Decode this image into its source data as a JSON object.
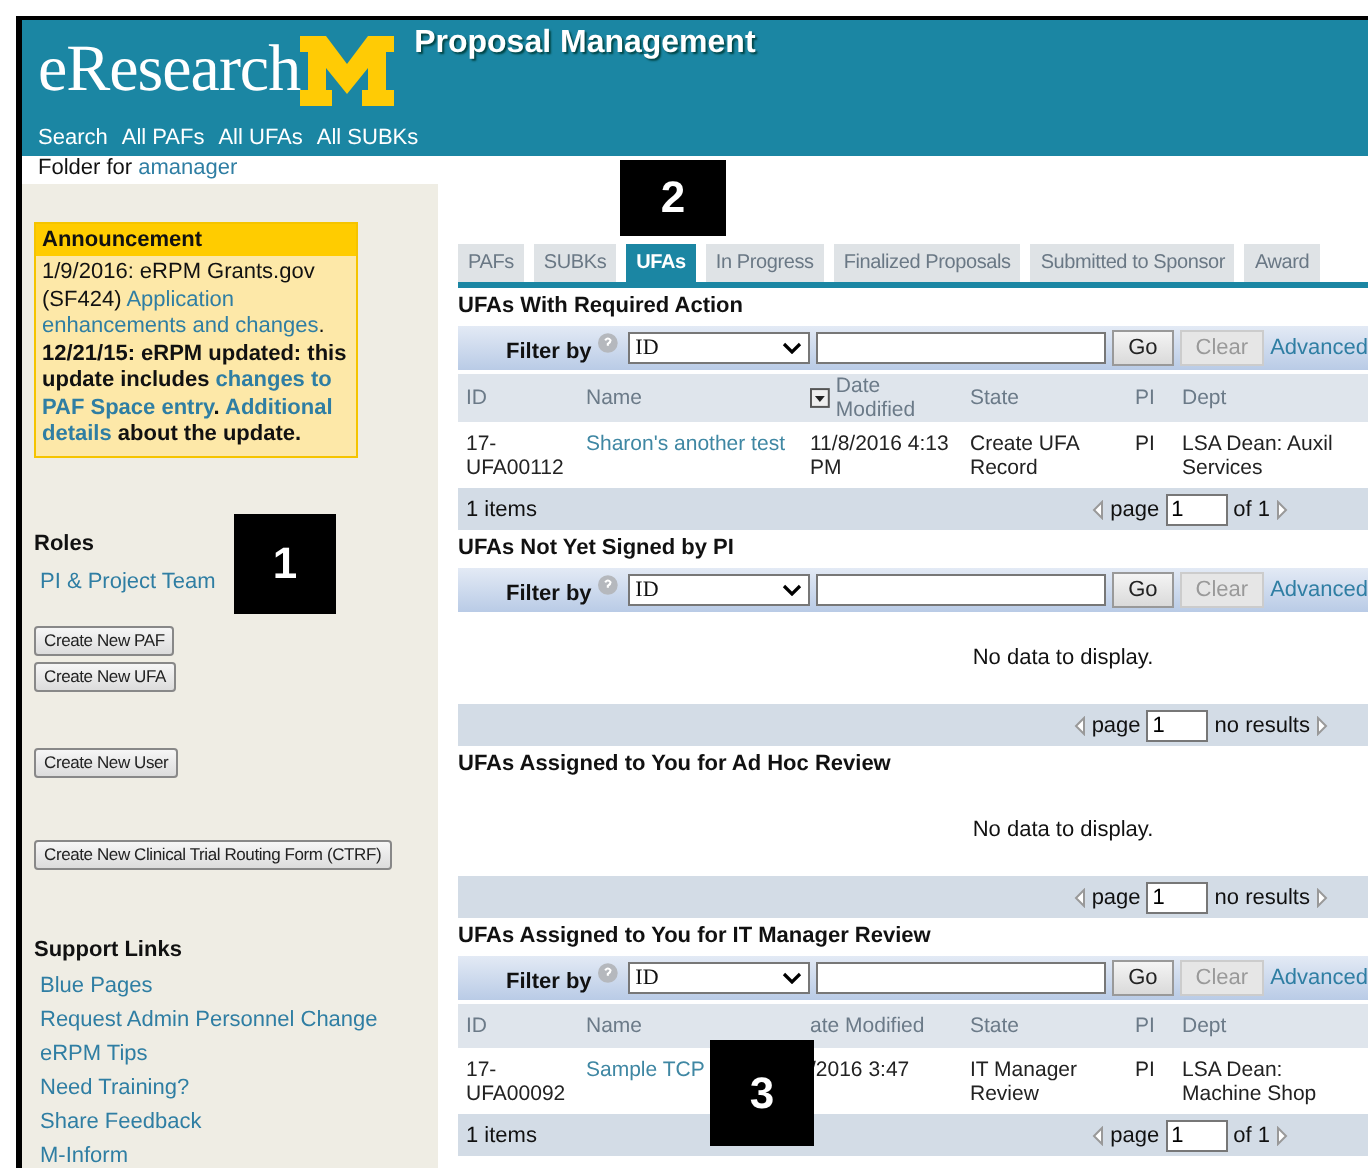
{
  "header": {
    "logo_text": "eResearch",
    "title": "Proposal Management",
    "nav": [
      "Search",
      "All PAFs",
      "All UFAs",
      "All SUBKs"
    ]
  },
  "folder": {
    "label": "Folder for",
    "user": "amanager"
  },
  "sidebar": {
    "announcement": {
      "title": "Announcement",
      "lines": [
        [
          {
            "kind": "text",
            "text": "1/9/2016: eRPM Grants.gov"
          }
        ],
        [
          {
            "kind": "text",
            "text": "(SF424) "
          },
          {
            "kind": "link",
            "text": "Application"
          }
        ],
        [
          {
            "kind": "link",
            "text": "enhancements and changes"
          },
          {
            "kind": "text",
            "text": "."
          }
        ],
        [
          {
            "kind": "bold",
            "text": "12/21/15: eRPM updated: this"
          }
        ],
        [
          {
            "kind": "bold",
            "text": "update includes "
          },
          {
            "kind": "boldlink",
            "text": "changes to"
          }
        ],
        [
          {
            "kind": "boldlink",
            "text": "PAF Space entry"
          },
          {
            "kind": "bold",
            "text": ". "
          },
          {
            "kind": "boldlink",
            "text": "Additional"
          }
        ],
        [
          {
            "kind": "boldlink",
            "text": "details"
          },
          {
            "kind": "bold",
            "text": " about the update."
          }
        ]
      ]
    },
    "roles": {
      "title": "Roles",
      "items": [
        "PI & Project Team"
      ]
    },
    "button_groups": [
      [
        "Create New PAF",
        "Create New UFA"
      ],
      [
        "Create New User"
      ],
      [
        "Create New Clinical Trial Routing Form (CTRF)"
      ]
    ],
    "support": {
      "title": "Support Links",
      "links": [
        "Blue Pages",
        "Request Admin Personnel Change",
        "eRPM Tips",
        "Need Training?",
        "Share Feedback",
        "M-Inform"
      ]
    }
  },
  "tabs": [
    {
      "label": "PAFs",
      "selected": false
    },
    {
      "label": "SUBKs",
      "selected": false
    },
    {
      "label": "UFAs",
      "selected": true
    },
    {
      "label": "In Progress",
      "selected": false
    },
    {
      "label": "Finalized Proposals",
      "selected": false
    },
    {
      "label": "Submitted to Sponsor",
      "selected": false
    },
    {
      "label": "Award",
      "selected": false
    }
  ],
  "sections": [
    {
      "title": "UFAs With Required Action",
      "filter": {
        "label": "Filter by",
        "field": "ID",
        "go": "Go",
        "clear": "Clear",
        "clear_disabled": true,
        "advanced": "Advanced"
      },
      "columns": [
        {
          "label": "ID",
          "sorted": false
        },
        {
          "label": "Name",
          "sorted": false
        },
        {
          "label": "Date Modified",
          "sorted": true
        },
        {
          "label": "State",
          "sorted": false
        },
        {
          "label": "PI",
          "sorted": false
        },
        {
          "label": "Dept",
          "sorted": false
        }
      ],
      "rows": [
        {
          "id": "17-UFA00112",
          "name": "Sharon's another test",
          "date": "11/8/2016 4:13 PM",
          "state": "Create UFA Record",
          "pi": "PI",
          "dept": "LSA Dean: Auxil Services"
        }
      ],
      "footer": {
        "count": "1 items",
        "page_label": "page",
        "page": "1",
        "total": "of 1"
      }
    },
    {
      "title": "UFAs Not Yet Signed by PI",
      "filter": {
        "label": "Filter by",
        "field": "ID",
        "go": "Go",
        "clear": "Clear",
        "clear_disabled": true,
        "advanced": "Advanced"
      },
      "empty": "No data to display.",
      "footer": {
        "page_label": "page",
        "page": "1",
        "total": "no results"
      }
    },
    {
      "title": "UFAs Assigned to You for Ad Hoc Review",
      "empty": "No data to display.",
      "footer": {
        "page_label": "page",
        "page": "1",
        "total": "no results"
      }
    },
    {
      "title": "UFAs Assigned to You for IT Manager Review",
      "filter": {
        "label": "Filter by",
        "field": "ID",
        "go": "Go",
        "clear": "Clear",
        "clear_disabled": true,
        "advanced": "Advanced"
      },
      "columns": [
        {
          "label": "ID",
          "sorted": false
        },
        {
          "label": "Name",
          "sorted": false
        },
        {
          "label": "ate Modified",
          "sorted": false
        },
        {
          "label": "State",
          "sorted": false
        },
        {
          "label": "PI",
          "sorted": false
        },
        {
          "label": "Dept",
          "sorted": false
        }
      ],
      "rows": [
        {
          "id": "17-UFA00092",
          "name": "Sample TCP",
          "date": "/2016 3:47",
          "state": "IT Manager Review",
          "pi": "PI",
          "dept": "LSA Dean: Machine Shop"
        }
      ],
      "footer": {
        "count": "1 items",
        "page_label": "page",
        "page": "1",
        "total": "of 1"
      }
    }
  ],
  "callouts": [
    "1",
    "2",
    "3"
  ]
}
